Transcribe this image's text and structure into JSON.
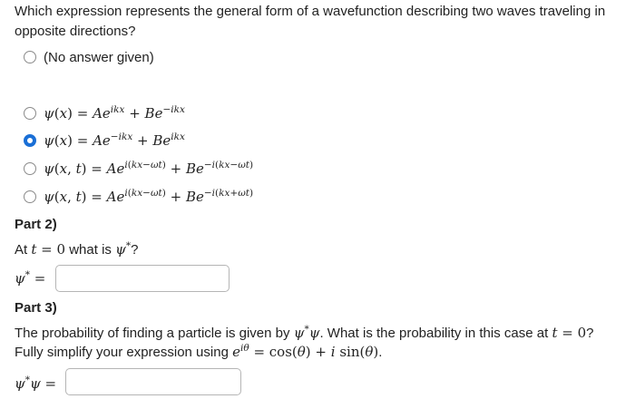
{
  "question": {
    "text": "Which expression represents the general form of a wavefunction describing two waves traveling in opposite directions?"
  },
  "options": [
    {
      "label": "(No answer given)",
      "selected": false
    },
    {
      "label": "ψ(x) = Ae^{ikx} + Be^{−ikx}",
      "selected": false
    },
    {
      "label": "ψ(x) = Ae^{−ikx} + Be^{ikx}",
      "selected": true
    },
    {
      "label": "ψ(x,t) = Ae^{i(kx−ωt)} + Be^{−i(kx−ωt)}",
      "selected": false
    },
    {
      "label": "ψ(x,t) = Ae^{i(kx−ωt)} + Be^{−i(kx+ωt)}",
      "selected": false
    }
  ],
  "part2": {
    "heading": "Part 2)",
    "prompt_before": "At",
    "prompt_math": "t = 0",
    "prompt_after": "what is",
    "prompt_end": "?",
    "answer_label": "ψ* =",
    "answer_value": ""
  },
  "part3": {
    "heading": "Part 3)",
    "line1_a": "The probability of finding a particle is given by",
    "line1_b": ". What is the probability in this case at",
    "line1_c": "?",
    "line2_a": "Fully simplify your expression using",
    "line2_b": ".",
    "answer_label": "ψ*ψ =",
    "answer_value": ""
  },
  "colors": {
    "selected_radio": "#1a6fd6",
    "text": "#222222",
    "input_border": "#b5b5b5"
  }
}
